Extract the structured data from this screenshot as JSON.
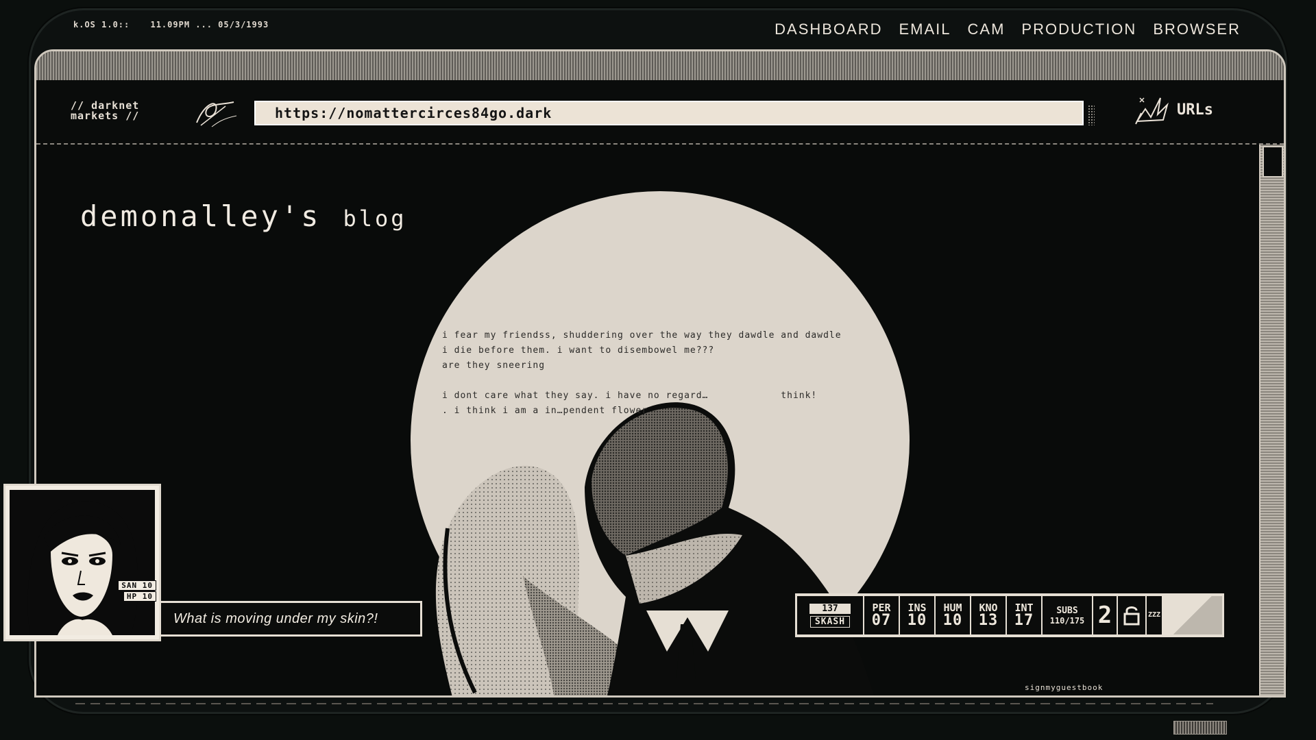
{
  "system": {
    "os": "k.OS 1.0::",
    "clock": "11.09PM ... 05/3/1993"
  },
  "nav": {
    "items": [
      "DASHBOARD",
      "EMAIL",
      "CAM",
      "PRODUCTION",
      "BROWSER"
    ]
  },
  "browser": {
    "sidebar_label": "// darknet\nmarkets //",
    "url": "https://nomattercirces84go.dark",
    "urls_label": "URLs"
  },
  "page": {
    "title_main": "demonalley's",
    "title_sub": "blog",
    "poem": "i fear my friendss, shuddering over the way they dawdle and dawdle\ni die before them. i want to disembowel me???\nare they sneering\n\ni dont care what they say. i have no regard…            think!\n. i think i am a in…pendent flower",
    "guestbook_label": "signmyguestbook"
  },
  "character": {
    "badges": [
      "SAN 10",
      "HP 10"
    ],
    "dialog": "What is moving under my skin?!"
  },
  "hud": {
    "id_number": "137",
    "id_name": "SKASH",
    "stats": [
      {
        "key": "PER",
        "value": "07"
      },
      {
        "key": "INS",
        "value": "10"
      },
      {
        "key": "HUM",
        "value": "10"
      },
      {
        "key": "KNO",
        "value": "13"
      },
      {
        "key": "INT",
        "value": "17"
      }
    ],
    "subs_label": "SUBS",
    "subs_value": "110/175",
    "big_number": "2",
    "zz": "ZZZ"
  },
  "colors": {
    "paper": "#dcd5cb",
    "ink": "#0b0c0b",
    "highlight": "#ece3d6"
  }
}
